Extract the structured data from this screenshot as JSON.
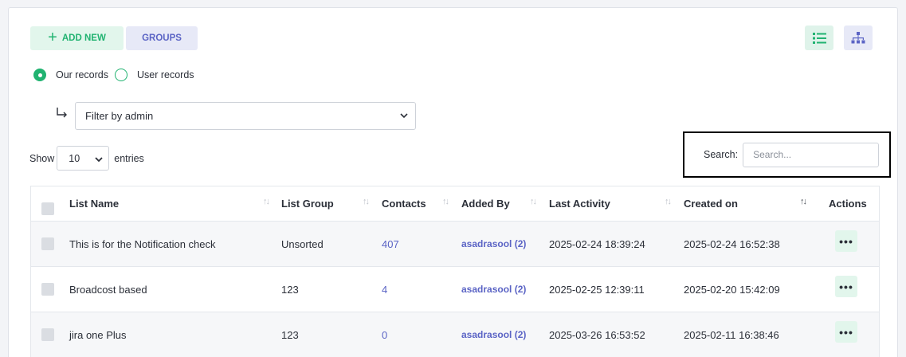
{
  "toolbar": {
    "add_new_label": "ADD NEW",
    "groups_label": "GROUPS"
  },
  "colors": {
    "accent_green": "#21b371",
    "accent_indigo": "#5b64c5"
  },
  "records": {
    "our_label": "Our records",
    "user_label": "User records",
    "selected": "our"
  },
  "filter": {
    "value": "Filter by admin"
  },
  "entries": {
    "show_label": "Show",
    "value": "10",
    "suffix": "entries"
  },
  "search": {
    "label": "Search:",
    "placeholder": "Search..."
  },
  "table": {
    "headers": [
      "List Name",
      "List Group",
      "Contacts",
      "Added By",
      "Last Activity",
      "Created on",
      "Actions"
    ],
    "rows": [
      {
        "name": "This is for the Notification check",
        "group": "Unsorted",
        "contacts": "407",
        "added_by": "asadrasool (2)",
        "last_activity": "2025-02-24 18:39:24",
        "created_on": "2025-02-24 16:52:38",
        "actions": "•••"
      },
      {
        "name": "Broadcost based",
        "group": "123",
        "contacts": "4",
        "added_by": "asadrasool (2)",
        "last_activity": "2025-02-25 12:39:11",
        "created_on": "2025-02-20 15:42:09",
        "actions": "•••"
      },
      {
        "name": "jira one Plus",
        "group": "123",
        "contacts": "0",
        "added_by": "asadrasool (2)",
        "last_activity": "2025-03-26 16:53:52",
        "created_on": "2025-02-11 16:38:46",
        "actions": "•••"
      }
    ]
  }
}
